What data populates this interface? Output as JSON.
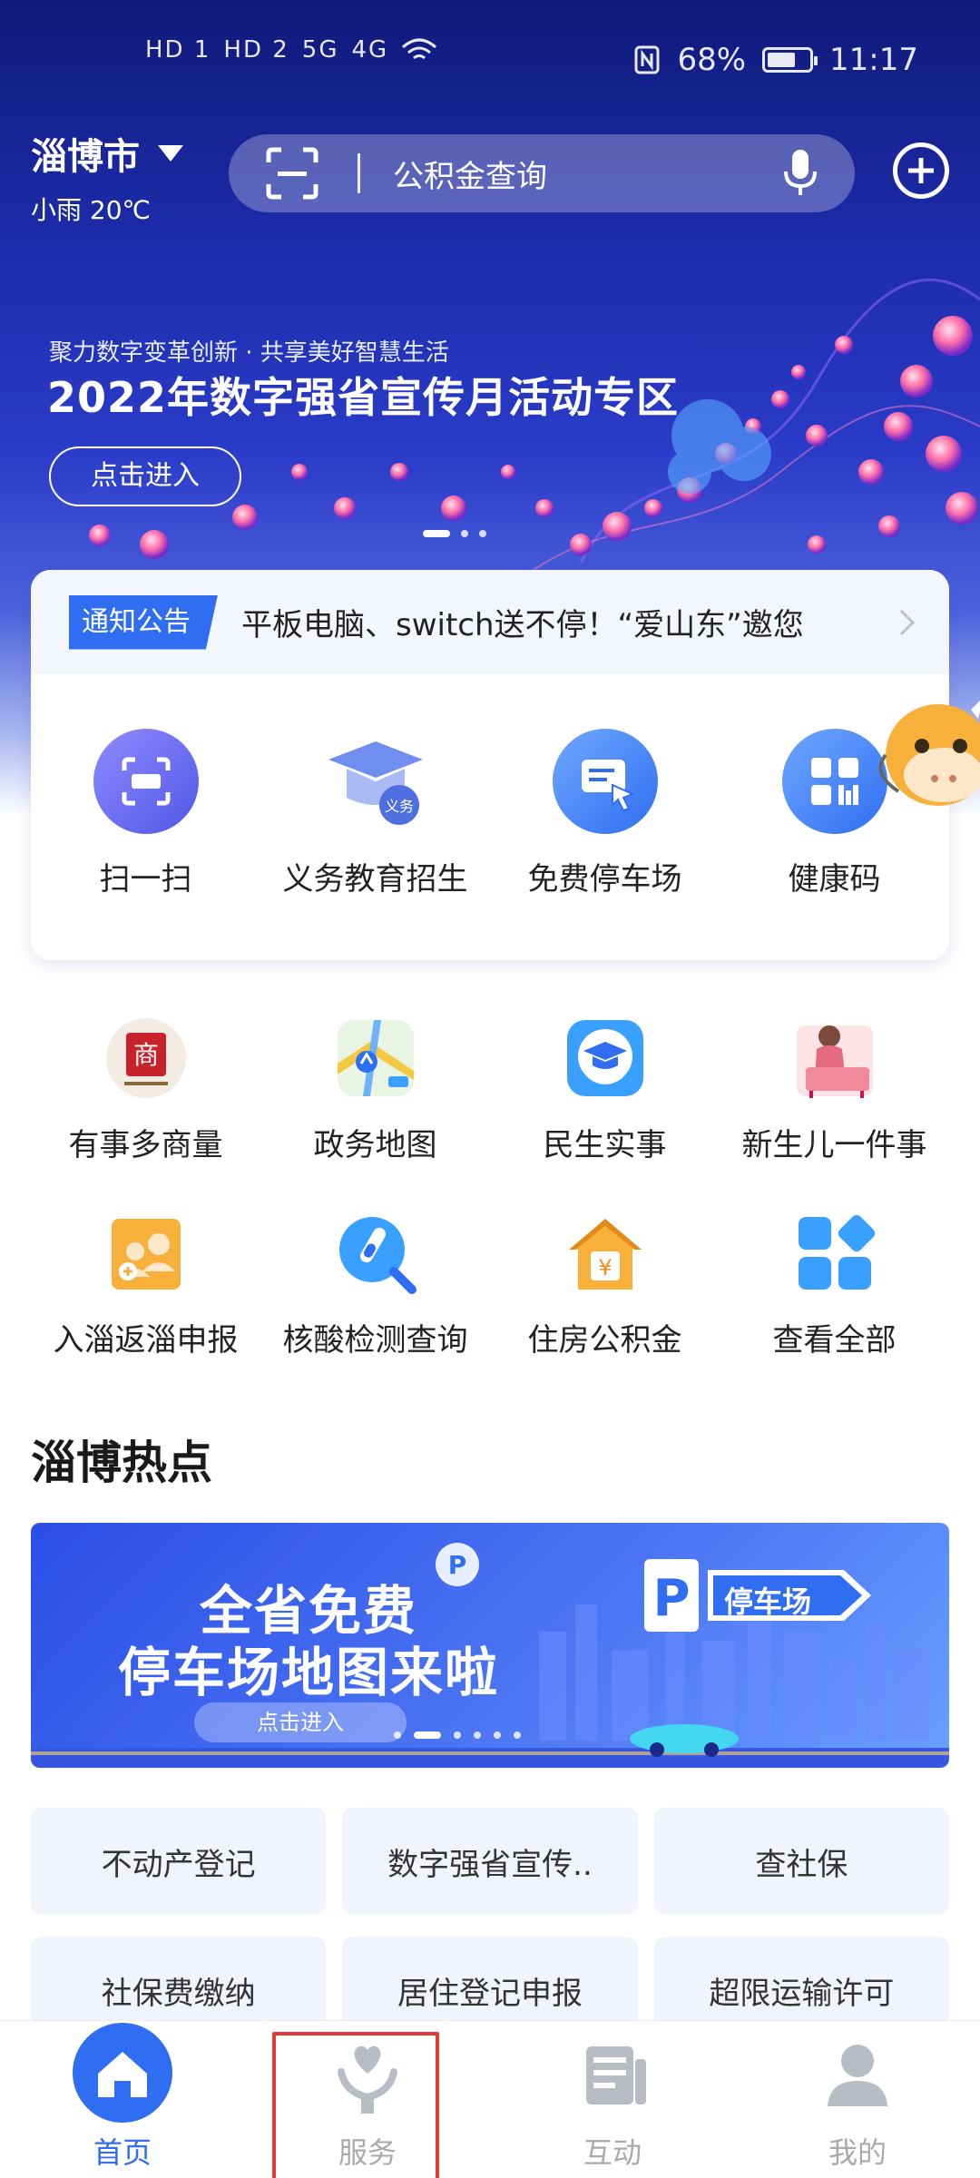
{
  "status_bar": {
    "left_labels": [
      "HD 1",
      "HD 2",
      "5G",
      "4G"
    ],
    "battery": "68%",
    "time": "11:17"
  },
  "header": {
    "city": "淄博市",
    "weather": "小雨 20℃",
    "search_placeholder": "公积金查询"
  },
  "hero_banner": {
    "subtitle": "聚力数字变革创新 · 共享美好智慧生活",
    "title": "2022年数字强省宣传月活动专区",
    "button": "点击进入",
    "active_slide": 1,
    "total_slides": 3
  },
  "notice": {
    "tag": "通知公告",
    "text": "平板电脑、switch送不停！“爱山东”邀您"
  },
  "quick_actions": [
    {
      "label": "扫一扫",
      "icon": "scan-icon"
    },
    {
      "label": "义务教育招生",
      "icon": "graduation-cap-icon"
    },
    {
      "label": "免费停车场",
      "icon": "parking-sign-icon"
    },
    {
      "label": "健康码",
      "icon": "qr-grid-icon"
    }
  ],
  "services": {
    "row1": [
      {
        "label": "有事多商量",
        "icon": "seal-icon"
      },
      {
        "label": "政务地图",
        "icon": "map-icon"
      },
      {
        "label": "民生实事",
        "icon": "mortarboard-icon"
      },
      {
        "label": "新生儿一件事",
        "icon": "mother-baby-icon"
      }
    ],
    "row2": [
      {
        "label": "入淄返淄申报",
        "icon": "people-report-icon"
      },
      {
        "label": "核酸检测查询",
        "icon": "test-tube-search-icon"
      },
      {
        "label": "住房公积金",
        "icon": "house-yuan-icon"
      },
      {
        "label": "查看全部",
        "icon": "all-apps-icon"
      }
    ]
  },
  "hot": {
    "title": "淄博热点",
    "banner_line1": "全省免费",
    "banner_line2": "停车场地图来啦",
    "banner_button": "点击进入",
    "sign_text": "停车场",
    "active_slide": 1,
    "total_slides": 6
  },
  "chips": [
    "不动产登记",
    "数字强省宣传..",
    "查社保",
    "社保费缴纳",
    "居住登记申报",
    "超限运输许可"
  ],
  "bottom_nav": [
    {
      "label": "首页",
      "icon": "home-icon",
      "active": true
    },
    {
      "label": "服务",
      "icon": "service-heart-hand-icon",
      "active": false
    },
    {
      "label": "互动",
      "icon": "news-icon",
      "active": false
    },
    {
      "label": "我的",
      "icon": "user-icon",
      "active": false
    }
  ],
  "colors": {
    "accent": "#2f6ef2",
    "hero_dark": "#101a7a",
    "highlight_box": "#e53935"
  }
}
